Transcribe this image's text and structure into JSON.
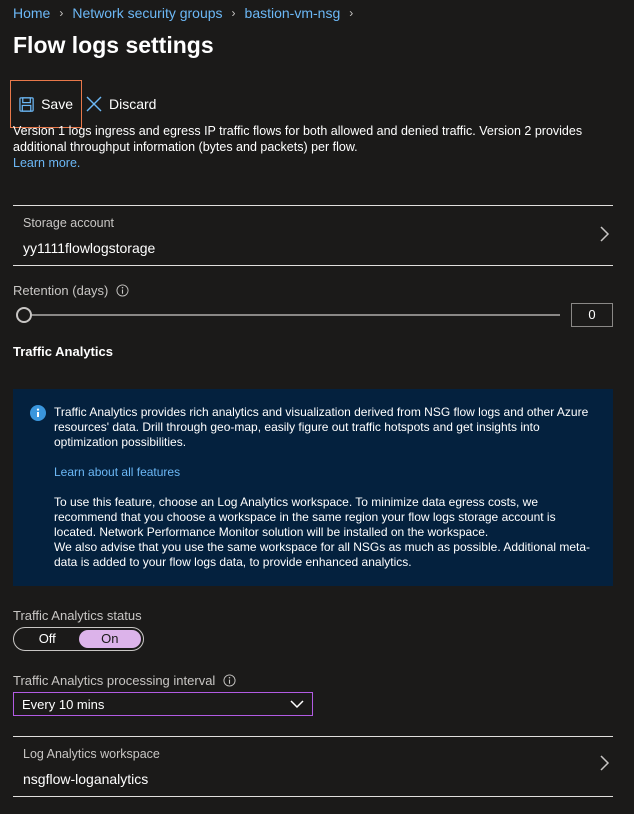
{
  "breadcrumb": {
    "items": [
      "Home",
      "Network security groups",
      "bastion-vm-nsg"
    ]
  },
  "page": {
    "title": "Flow logs settings"
  },
  "toolbar": {
    "save_label": "Save",
    "discard_label": "Discard"
  },
  "description": {
    "text": "Version 1 logs ingress and egress IP traffic flows for both allowed and denied traffic. Version 2 provides additional throughput information (bytes and packets) per flow.",
    "link": "Learn more."
  },
  "storage": {
    "label": "Storage account",
    "value": "yy1111flowlogstorage"
  },
  "retention": {
    "label": "Retention (days)",
    "value": "0",
    "level": 0
  },
  "traffic_analytics": {
    "title": "Traffic Analytics",
    "info_para1": "Traffic Analytics provides rich analytics and visualization derived from NSG flow logs and other Azure resources' data. Drill through geo-map, easily figure out traffic hotspots and get insights into optimization possibilities.",
    "info_link": "Learn about all features",
    "info_para2a": "To use this feature, choose an Log Analytics workspace. To minimize data egress costs, we recommend that you choose a workspace in the same region your flow logs storage account is located. Network Performance Monitor solution will be installed on the workspace.",
    "info_para2b": "We also advise that you use the same workspace for all NSGs as much as possible. Additional meta-data is added to your flow logs data, to provide enhanced analytics.",
    "status_label": "Traffic Analytics status",
    "status_off": "Off",
    "status_on": "On",
    "interval_label": "Traffic Analytics processing interval",
    "interval_value": "Every 10 mins",
    "workspace_label": "Log Analytics workspace",
    "workspace_value": "nsgflow-loganalytics"
  },
  "colors": {
    "background": "#1b1a19",
    "link": "#6cb8f6",
    "save_highlight": "#e8784a",
    "info_background": "#04213e",
    "toggle_on": "#dcb3ea",
    "dropdown_border": "#b25be3"
  },
  "icons": [
    "chevron-right-icon",
    "save-icon",
    "close-icon",
    "info-icon",
    "chevron-down-icon"
  ]
}
